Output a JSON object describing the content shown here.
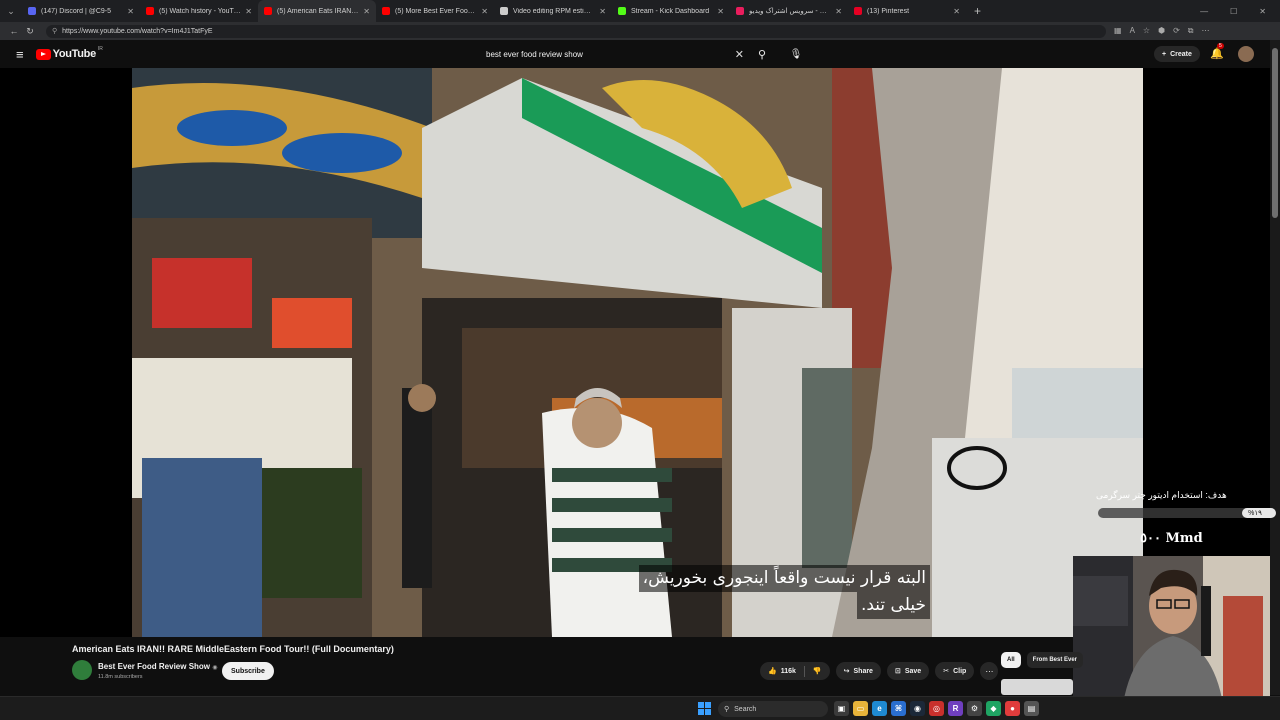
{
  "browser": {
    "tabs": [
      {
        "title": "(147) Discord | @C9-5",
        "color": "#5865f2",
        "active": false
      },
      {
        "title": "(5) Watch history - YouTube",
        "color": "#ff0000",
        "active": false
      },
      {
        "title": "(5) American Eats IRAN!! RA",
        "color": "#ff0000",
        "active": true
      },
      {
        "title": "(5) More Best Ever Food Review S",
        "color": "#ff0000",
        "active": false
      },
      {
        "title": "Video editing RPM estimate",
        "color": "#cccccc",
        "active": false
      },
      {
        "title": "Stream - Kick Dashboard",
        "color": "#53fc18",
        "active": false
      },
      {
        "title": "آپارات - سرویس اشتراک ویدیو",
        "color": "#ea1d5d",
        "active": false
      },
      {
        "title": "(13) Pinterest",
        "color": "#e60023",
        "active": false
      }
    ],
    "new_tab": "+",
    "url": "https://www.youtube.com/watch?v=Im4J1TatFyE"
  },
  "youtube": {
    "logo_text": "YouTube",
    "logo_superscript": "IR",
    "search_query": "best ever food review show",
    "create_label": "Create",
    "notification_count": "5"
  },
  "video": {
    "subtitle_line1": "البته قرار نیست واقعاً اینجوری بخوریش،",
    "subtitle_line2": "خیلی تند.",
    "title": "American Eats IRAN!! RARE MiddleEastern Food Tour!! (Full Documentary)",
    "channel_name": "Best Ever Food Review Show",
    "verified": "◉",
    "subscribers": "11.8m subscribers",
    "subscribe_label": "Subscribe",
    "likes": "116k",
    "share_label": "Share",
    "save_label": "Save",
    "clip_label": "Clip"
  },
  "stream_overlay": {
    "goal_text": "هدف: استخدام ادیتور چتر سرگرمی",
    "goal_percent_label": "%۱۹",
    "goal_progress": 0.19,
    "amount_text": "٥٠٠ Mmd"
  },
  "related_chips": [
    "All",
    "From Best Ever"
  ],
  "taskbar": {
    "search_placeholder": "Search"
  }
}
